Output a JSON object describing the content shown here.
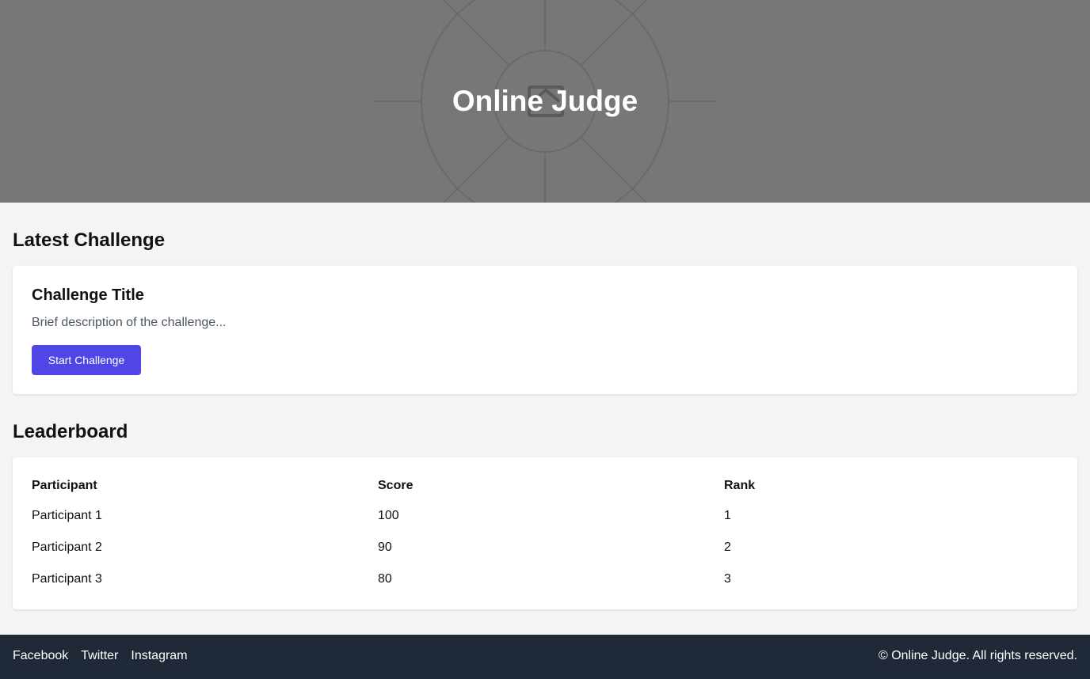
{
  "hero": {
    "title": "Online Judge"
  },
  "latest_challenge": {
    "heading": "Latest Challenge",
    "title": "Challenge Title",
    "description": "Brief description of the challenge...",
    "button_label": "Start Challenge"
  },
  "leaderboard": {
    "heading": "Leaderboard",
    "columns": [
      "Participant",
      "Score",
      "Rank"
    ],
    "rows": [
      [
        "Participant 1",
        "100",
        "1"
      ],
      [
        "Participant 2",
        "90",
        "2"
      ],
      [
        "Participant 3",
        "80",
        "3"
      ]
    ]
  },
  "footer": {
    "links": [
      "Facebook",
      "Twitter",
      "Instagram"
    ],
    "copyright": "© Online Judge. All rights reserved."
  },
  "colors": {
    "accent": "#4f46e5",
    "hero_bg": "#777777",
    "footer_bg": "#1f2937",
    "page_bg": "#f3f4f6"
  },
  "icons": {
    "hero_background": "image-placeholder-icon"
  }
}
